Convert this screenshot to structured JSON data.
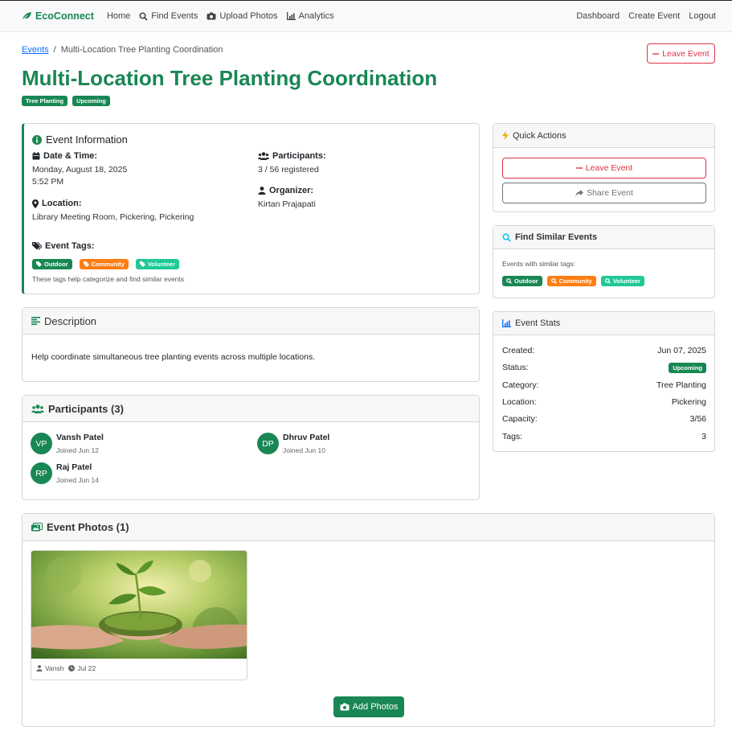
{
  "nav": {
    "brand": "EcoConnect",
    "left": [
      "Home",
      "Find Events",
      "Upload Photos",
      "Analytics"
    ],
    "right": [
      "Dashboard",
      "Create Event",
      "Logout"
    ]
  },
  "breadcrumb": {
    "root": "Events",
    "separator": "/",
    "current": "Multi-Location Tree Planting Coordination"
  },
  "leave_event_top": "Leave Event",
  "title": "Multi-Location Tree Planting Coordination",
  "title_badges": [
    "Tree Planting",
    "Upcoming"
  ],
  "event_info": {
    "heading": "Event Information",
    "date_label": "Date & Time:",
    "date": "Monday, August 18, 2025",
    "time": "5:52 PM",
    "location_label": "Location:",
    "location": "Library Meeting Room, Pickering, Pickering",
    "participants_label": "Participants:",
    "participants": "3 / 56 registered",
    "organizer_label": "Organizer:",
    "organizer": "Kirtan Prajapati",
    "tags_label": "Event Tags:",
    "tags": [
      "Outdoor",
      "Community",
      "Volunteer"
    ],
    "tags_note": "These tags help categorize and find similar events"
  },
  "description": {
    "heading": "Description",
    "text": "Help coordinate simultaneous tree planting events across multiple locations."
  },
  "participants": {
    "heading": "Participants (3)",
    "list": [
      {
        "initials": "VP",
        "name": "Vansh Patel",
        "joined": "Joined Jun 12"
      },
      {
        "initials": "DP",
        "name": "Dhruv Patel",
        "joined": "Joined Jun 10"
      },
      {
        "initials": "RP",
        "name": "Raj Patel",
        "joined": "Joined Jun 14"
      }
    ]
  },
  "quick_actions": {
    "heading": "Quick Actions",
    "leave": "Leave Event",
    "share": "Share Event"
  },
  "similar": {
    "heading": "Find Similar Events",
    "label": "Events with similar tags:",
    "tags": [
      "Outdoor",
      "Community",
      "Volunteer"
    ]
  },
  "stats": {
    "heading": "Event Stats",
    "rows": [
      {
        "label": "Created:",
        "value": "Jun 07, 2025"
      },
      {
        "label": "Status:",
        "value": "Upcoming"
      },
      {
        "label": "Category:",
        "value": "Tree Planting"
      },
      {
        "label": "Location:",
        "value": "Pickering"
      },
      {
        "label": "Capacity:",
        "value": "3/56"
      },
      {
        "label": "Tags:",
        "value": "3"
      }
    ]
  },
  "photos": {
    "heading": "Event Photos (1)",
    "items": [
      {
        "author": "Vansh",
        "date": "Jul 22"
      }
    ],
    "add_button": "Add Photos"
  },
  "colors": {
    "primary_green": "#198754",
    "danger": "#dc3545",
    "tag_orange": "#fd7e14",
    "tag_teal": "#20c997",
    "link_blue": "#0d6efd"
  }
}
